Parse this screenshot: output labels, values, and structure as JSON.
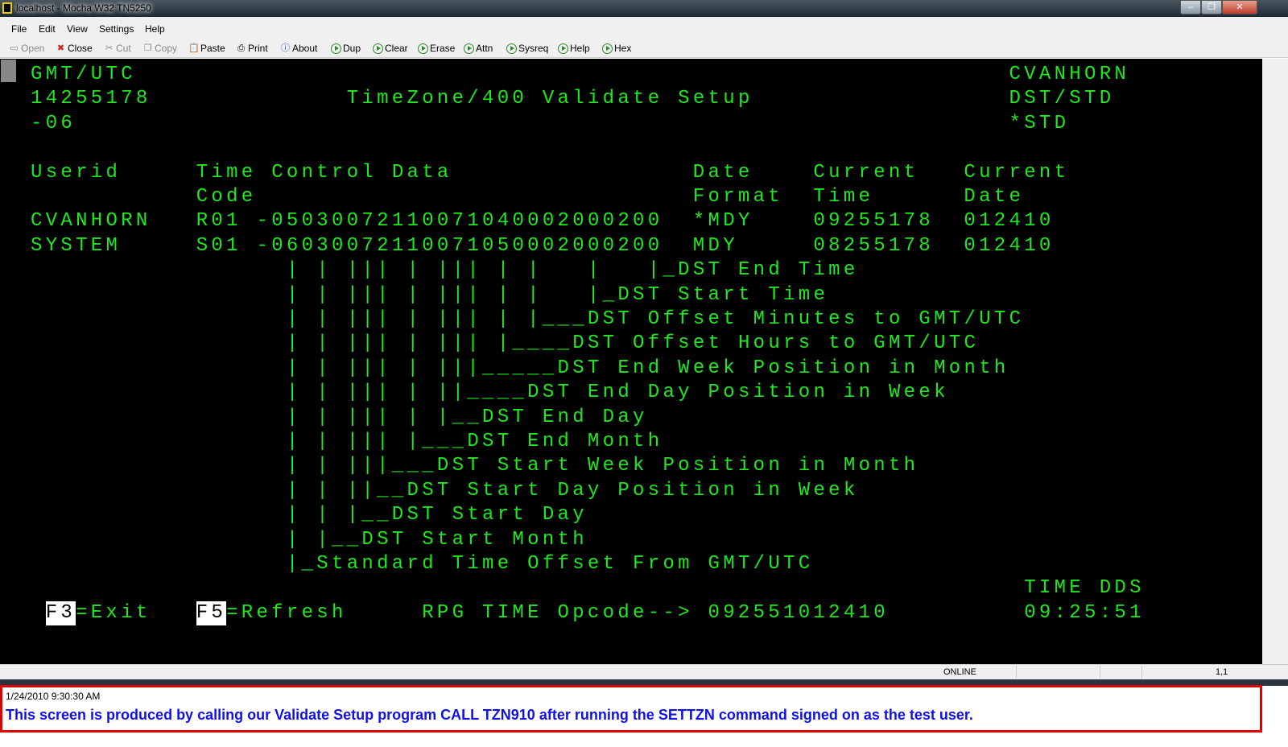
{
  "window": {
    "title": "localhost - Mocha W32 TN5250",
    "minimize": "–",
    "restore": "❐",
    "close": "✕"
  },
  "menu": [
    "File",
    "Edit",
    "View",
    "Settings",
    "Help"
  ],
  "toolbar": [
    {
      "label": "Open",
      "icon": "computer-icon",
      "enabled": false
    },
    {
      "label": "Close",
      "icon": "close-x-icon",
      "enabled": true
    },
    {
      "label": "Cut",
      "icon": "scissors-icon",
      "enabled": false
    },
    {
      "label": "Copy",
      "icon": "copy-icon",
      "enabled": false
    },
    {
      "label": "Paste",
      "icon": "paste-icon",
      "enabled": true
    },
    {
      "label": "Print",
      "icon": "printer-icon",
      "enabled": true
    },
    {
      "label": "About",
      "icon": "info-icon",
      "enabled": true
    },
    {
      "label": "Dup",
      "icon": "play-icon",
      "enabled": true
    },
    {
      "label": "Clear",
      "icon": "play-icon",
      "enabled": true
    },
    {
      "label": "Erase",
      "icon": "play-icon",
      "enabled": true
    },
    {
      "label": "Attn",
      "icon": "play-icon",
      "enabled": true
    },
    {
      "label": "Sysreq",
      "icon": "play-icon",
      "enabled": true
    },
    {
      "label": "Help",
      "icon": "play-icon",
      "enabled": true
    },
    {
      "label": "Hex",
      "icon": "play-icon",
      "enabled": true
    }
  ],
  "terminal": {
    "color": "#1fe81f",
    "header": {
      "tz_label": "GMT/UTC",
      "time": "14255178",
      "offset": "-06",
      "title": "TimeZone/400 Validate Setup",
      "user": "CVANHORN",
      "dst_label": "DST/STD",
      "dst_value": "*STD"
    },
    "columns": {
      "userid": "Userid",
      "tcd": "Time Control Data",
      "code": "Code",
      "date1": "Date",
      "date2": "Format",
      "ctime1": "Current",
      "ctime2": "Time",
      "cdate1": "Current",
      "cdate2": "Date"
    },
    "rows": [
      {
        "userid": "CVANHORN",
        "code": "R01",
        "data": "-05030072110071040002000200",
        "format": "*MDY",
        "time": "09255178",
        "date": "012410"
      },
      {
        "userid": "SYSTEM",
        "code": "S01",
        "data": "-06030072110071050002000200",
        "format": "MDY",
        "time": "08255178",
        "date": "012410"
      }
    ],
    "legend": [
      "| | ||| | ||| | |   |   |_DST End Time",
      "| | ||| | ||| | |   |_DST Start Time",
      "| | ||| | ||| | |___DST Offset Minutes to GMT/UTC",
      "| | ||| | ||| |____DST Offset Hours to GMT/UTC",
      "| | ||| | |||_____DST End Week Position in Month",
      "| | ||| | ||____DST End Day Position in Week",
      "| | ||| | |__DST End Day",
      "| | ||| |___DST End Month",
      "| | |||___DST Start Week Position in Month",
      "| | ||__DST Start Day Position in Week",
      "| | |__DST Start Day",
      "| |__DST Start Month",
      "|_Standard Time Offset From GMT/UTC"
    ],
    "footer": {
      "f3": "F3",
      "f3_label": "=Exit",
      "f5": "F5",
      "f5_label": "=Refresh",
      "rpg_label": "RPG TIME Opcode-->",
      "rpg_value": "092551012410",
      "dds_label": "TIME DDS",
      "dds_value": "09:25:51"
    }
  },
  "status": {
    "connection": "ONLINE",
    "cursor": "1,1"
  },
  "caption": {
    "date": "1/24/2010 9:30:30 AM",
    "text": "This screen is produced by calling our Validate Setup program CALL TZN910 after running the SETTZN command signed on as the test user."
  }
}
